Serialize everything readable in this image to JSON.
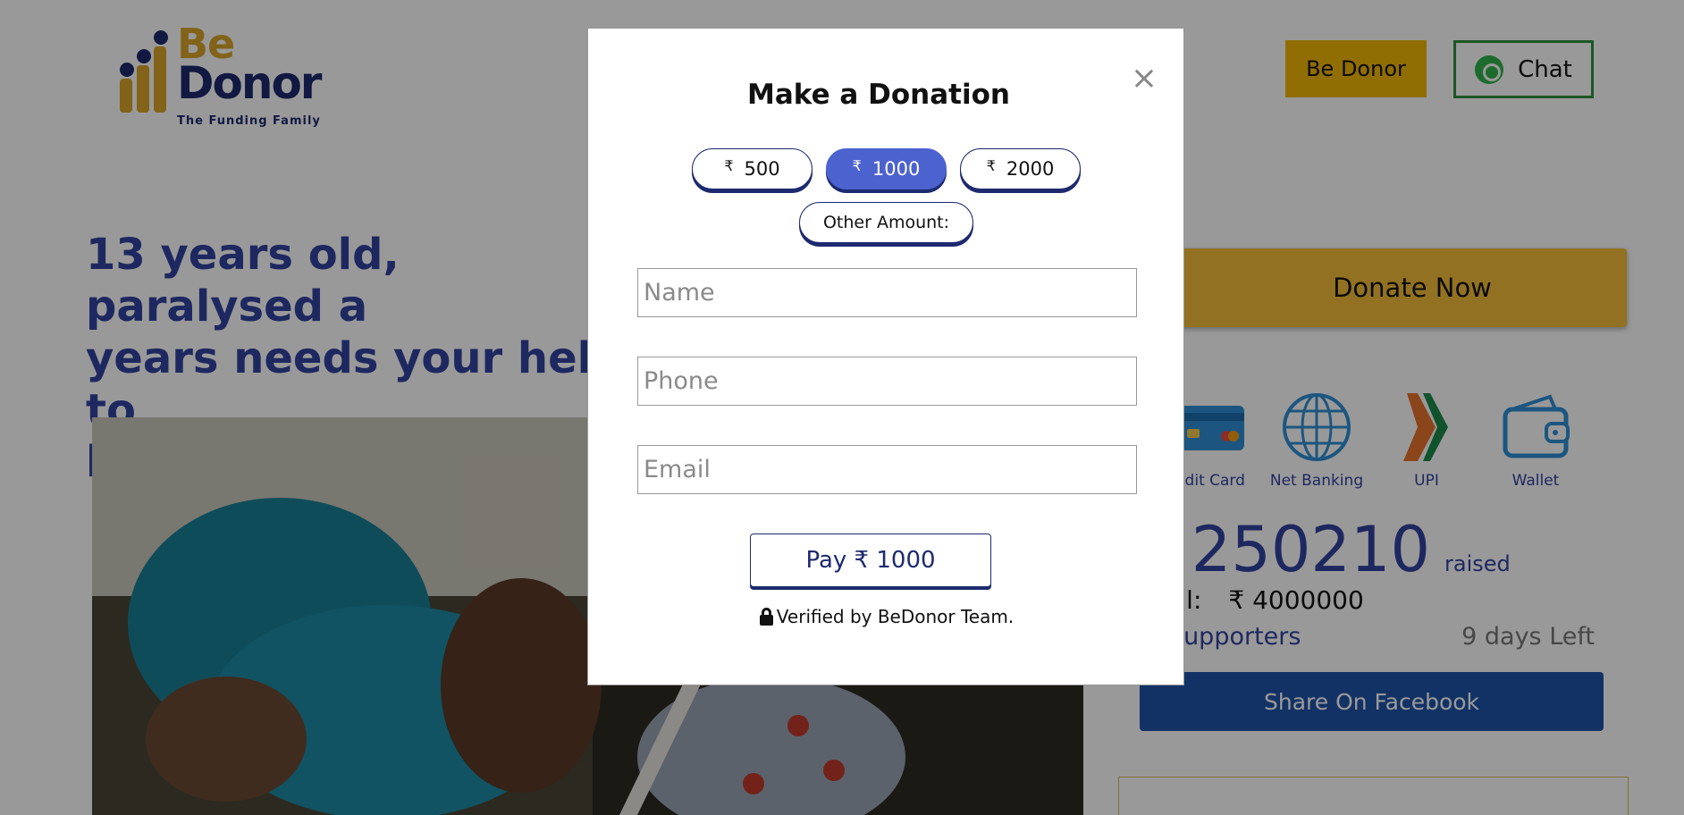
{
  "header": {
    "logo": {
      "be": "Be",
      "donor": "Donor",
      "tagline": "The Funding Family"
    },
    "be_donor_label": "Be Donor",
    "chat_label": "Chat"
  },
  "campaign": {
    "title": "13 years old, paralysed a... years needs your help to... brain",
    "title_lines": [
      "13 years old, paralysed a",
      "years needs your help to",
      "brain"
    ]
  },
  "sidebar": {
    "donate_now_label": "Donate Now",
    "payment_methods": [
      {
        "label": "edit Card",
        "icon": "credit-card-icon"
      },
      {
        "label": "Net Banking",
        "icon": "globe-icon"
      },
      {
        "label": "UPI",
        "icon": "upi-icon"
      },
      {
        "label": "Wallet",
        "icon": "wallet-icon"
      }
    ],
    "raised_amount": "₹ 250210",
    "raised_word": "raised",
    "goal_label": "al:",
    "goal_value": "₹ 4000000",
    "supporters_label": "supporters",
    "days_left": "9 days Left",
    "share_facebook_label": "Share On Facebook"
  },
  "modal": {
    "title": "Make a Donation",
    "close_glyph": "×",
    "amount_options": [
      {
        "currency": "₹",
        "value": "500",
        "selected": false
      },
      {
        "currency": "₹",
        "value": "1000",
        "selected": true
      },
      {
        "currency": "₹",
        "value": "2000",
        "selected": false
      }
    ],
    "other_amount_label": "Other Amount:",
    "fields": {
      "name_placeholder": "Name",
      "phone_placeholder": "Phone",
      "email_placeholder": "Email"
    },
    "pay_label": "Pay ₹ 1000",
    "verified_text": "Verified by BeDonor Team."
  },
  "colors": {
    "brand_gold": "#f2b705",
    "brand_navy": "#1d2a6e",
    "accent_blue": "#4c62cf",
    "facebook_blue": "#1f54a8",
    "whatsapp_green": "#2f8f3c"
  }
}
